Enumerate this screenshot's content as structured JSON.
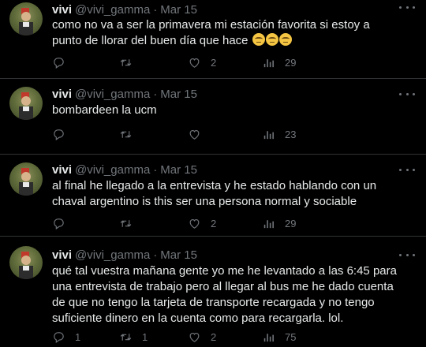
{
  "tweets": [
    {
      "name": "vivi",
      "handle": "@vivi_gamma",
      "sep": "·",
      "date": "Mar 15",
      "text": "como no va a ser la primavera mi estación favorita si estoy a punto de llorar del buen día que hace",
      "emojis": [
        "smiling-face-with-tear",
        "smiling-face-with-tear",
        "smiling-face-with-tear"
      ],
      "replies": "",
      "retweets": "",
      "likes": "2",
      "views": "29"
    },
    {
      "name": "vivi",
      "handle": "@vivi_gamma",
      "sep": "·",
      "date": "Mar 15",
      "text": "bombardeen la ucm",
      "emojis": [],
      "replies": "",
      "retweets": "",
      "likes": "",
      "views": "23"
    },
    {
      "name": "vivi",
      "handle": "@vivi_gamma",
      "sep": "·",
      "date": "Mar 15",
      "text": "al final he llegado a la entrevista y he estado hablando con un chaval argentino is this ser una persona normal y sociable",
      "emojis": [],
      "replies": "",
      "retweets": "",
      "likes": "2",
      "views": "29"
    },
    {
      "name": "vivi",
      "handle": "@vivi_gamma",
      "sep": "·",
      "date": "Mar 15",
      "text": "qué tal vuestra mañana gente yo me he levantado a las 6:45 para una entrevista de trabajo pero al llegar al bus me he dado cuenta de que no tengo la tarjeta de transporte recargada y no tengo suficiente dinero en la cuenta como para recargarla. lol.",
      "emojis": [],
      "replies": "1",
      "retweets": "1",
      "likes": "2",
      "views": "75"
    }
  ],
  "icons": {
    "reply": "reply-icon",
    "retweet": "retweet-icon",
    "like": "heart-icon",
    "views": "analytics-icon",
    "more": "more-icon",
    "avatar": "avatar"
  }
}
